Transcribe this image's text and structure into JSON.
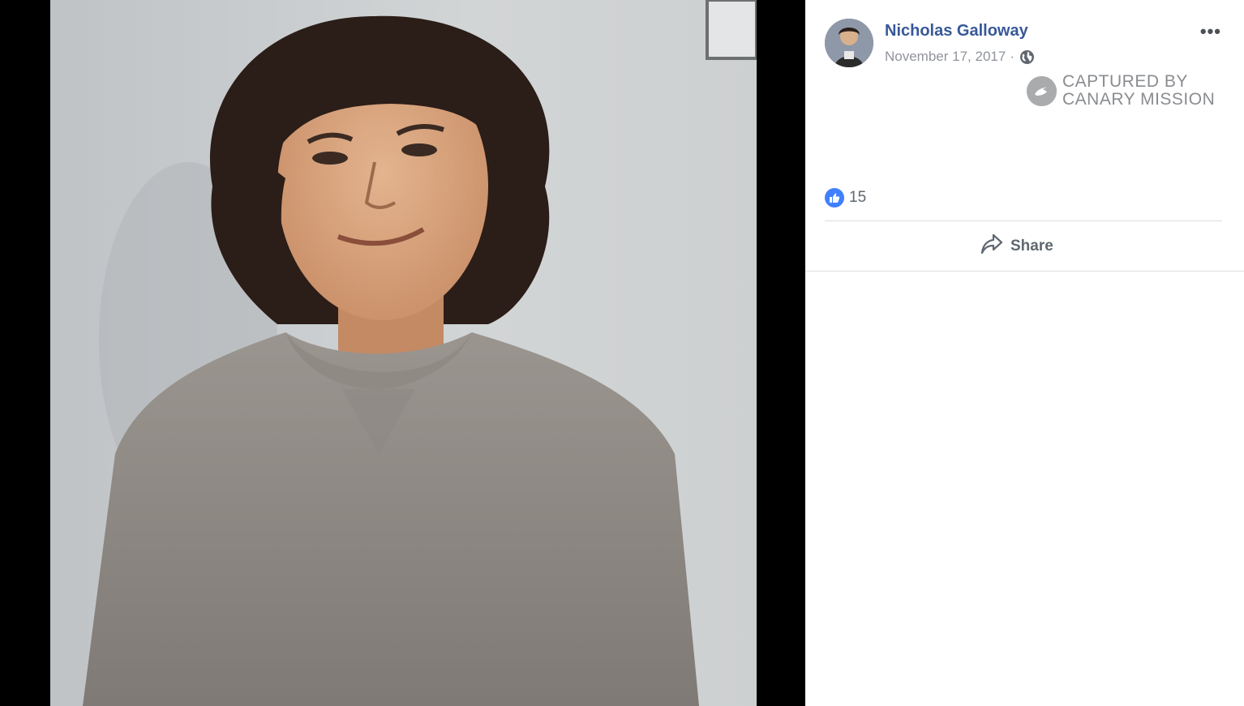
{
  "post": {
    "author": "Nicholas Galloway",
    "date": "November 17, 2017",
    "separator": "·",
    "privacy_icon": "globe-icon",
    "more_label": "•••"
  },
  "watermark": {
    "line1": "CAPTURED BY",
    "line2": "CANARY MISSION"
  },
  "reactions": {
    "icon": "like-icon",
    "count": "15"
  },
  "actions": {
    "share_label": "Share"
  },
  "colors": {
    "author_link": "#385898",
    "meta_text": "#90949c",
    "like_blue": "#4080ff",
    "theater_bg": "#000000"
  }
}
